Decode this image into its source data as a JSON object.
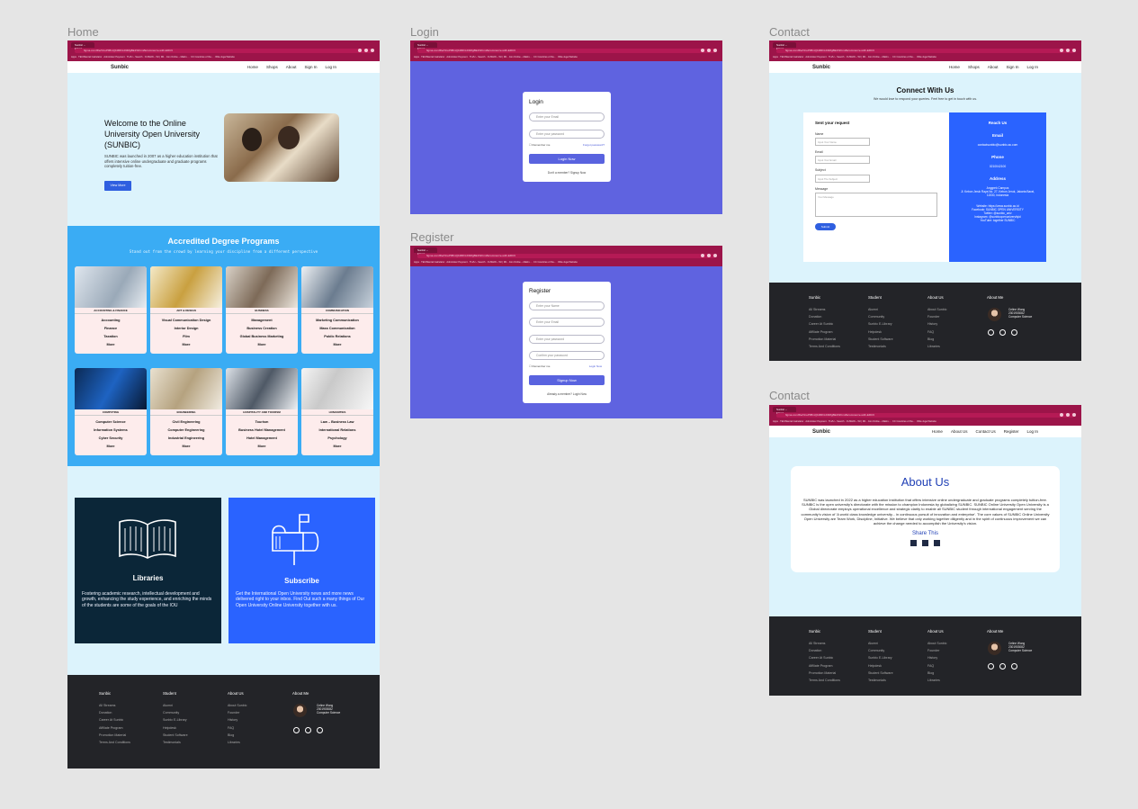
{
  "frames": {
    "home": "Home",
    "login": "Login",
    "register": "Register",
    "contact1": "Contact",
    "contact2": "Contact"
  },
  "browser": {
    "tab": "Sunbic – Figma",
    "url": "figma.com/file/OnuPlf8mQ1MRhLR3MgBE1WCmt/Ecommerce-with-ERC6",
    "bookmarks": "Apps · TEC/Mental Calculator · Administer Payment · TLVH – Search · CUSHIN – WI | M1 · Join Online – Makin... · CC Countries of the... · Wita Juga Website"
  },
  "nav": {
    "brand": "Sunbic",
    "links": [
      "Home",
      "Shops",
      "About",
      "Sign In",
      "Log In"
    ],
    "links_about": [
      "Home",
      "About Us",
      "Contact Us",
      "Register",
      "Log In"
    ]
  },
  "hero": {
    "title": "Welcome to the Online University Open University (SUNBIC)",
    "text": "SUNBIC was launched in 2007 as a higher education institution that offers intensive online undergraduate and graduate programs completely tuition-free.",
    "button": "View More"
  },
  "programs": {
    "title": "Accredited Degree Programs",
    "subtitle": "Stand out from the crowd by learning your discipline from a different perspective",
    "cards": [
      {
        "cat": "ACCOUNTING & FINANCE",
        "items": [
          "Accounting",
          "Finance",
          "Taxation",
          "More"
        ]
      },
      {
        "cat": "ART & DESIGN",
        "items": [
          "Visual Communication Design",
          "Interior Design",
          "Film",
          "More"
        ]
      },
      {
        "cat": "BUSINESS",
        "items": [
          "Management",
          "Business Creation",
          "Global Business Marketing",
          "More"
        ]
      },
      {
        "cat": "COMMUNICATION",
        "items": [
          "Marketing Communication",
          "Mass Communication",
          "Public Relations",
          "More"
        ]
      },
      {
        "cat": "COMPUTING",
        "items": [
          "Computer Science",
          "Information Systems",
          "Cyber Security",
          "More"
        ]
      },
      {
        "cat": "ENGINEERING",
        "items": [
          "Civil Engineering",
          "Computer Engineering",
          "Industrial Engineering",
          "More"
        ]
      },
      {
        "cat": "HOSPITALITY AND TOURISM",
        "items": [
          "Tourism",
          "Business Hotel Management",
          "Hotel Management",
          "More"
        ]
      },
      {
        "cat": "HUMANITIES",
        "items": [
          "Law – Business Law",
          "International Relations",
          "Psychology",
          "More"
        ]
      }
    ]
  },
  "libraries": {
    "title": "Libraries",
    "text": "Fostering academic research, intellectual development and growth, enhancing the study experience, and enriching the minds of the students are some of the goals of the IOU"
  },
  "subscribe": {
    "title": "Subscribe",
    "text": "Get the International Open University news and more news delivered right to your inbox. Find Out such a many things of Our Open University Online University together with us."
  },
  "footer": {
    "cols": [
      {
        "title": "Sunbic",
        "items": [
          "All Streams",
          "Donation",
          "Career At Sunbic",
          "Affiliate Program",
          "Promotion Material",
          "Terms And Conditions"
        ]
      },
      {
        "title": "Student",
        "items": [
          "Alumni",
          "Community",
          "Sunbic E-Library",
          "Helpdesk",
          "Student Software",
          "Testimonials"
        ]
      },
      {
        "title": "About Us",
        "items": [
          "About Sunbic",
          "Founder",
          "History",
          "FAQ",
          "Blog",
          "Libraries"
        ]
      },
      {
        "title": "About Me",
        "items": []
      }
    ],
    "me": [
      "Celine Wong",
      "2301903082",
      "Computer Science"
    ]
  },
  "login": {
    "title": "Login",
    "email": "Enter your Email",
    "password": "Enter your password",
    "remember": "Remember me",
    "forgot": "Forgot password?",
    "button": "Login Now",
    "signup_prompt": "Don't a member? Signup Now"
  },
  "register": {
    "title": "Register",
    "name": "Enter your Name",
    "email": "Enter your Email",
    "password": "Enter your password",
    "confirm": "Confirm your password",
    "remember": "Remember me",
    "login_link": "Login Now",
    "button": "Signup Now",
    "login_prompt": "Already a member? Login Now"
  },
  "contact": {
    "title": "Connect With Us",
    "subtitle": "We would love to respond your queries. Feel free to get in touch with us.",
    "form_title": "Sent your request",
    "labels": [
      "Name",
      "Email",
      "Subject",
      "Message"
    ],
    "placeholders": [
      "Input Your Name",
      "Input Your Email",
      "Input The Subject",
      "Your Message"
    ],
    "submit": "Submit",
    "reach": {
      "title": "Reach Us",
      "email_h": "Email",
      "email": "contactsunbic@sunbic.ac.com",
      "phone_h": "Phone",
      "phone": "0210042100",
      "address_h": "Address",
      "address": "Anggrek Campus\nJl. Kebon Jeruk Raya No. 27, Kebon Jeruk, Jakarta Barat, 11530, Indonesia",
      "socials": "Website: https://www.sunbic.ac.id\nFacebook: SUNBIC OPEN UNIVERSITY\nTwitter: @sunbic_univ\nInstagram: @sunbicopenuniversityid\nYouTube: together SUNBIC"
    }
  },
  "about": {
    "title": "About Us",
    "text": "SUNBIC was launched in 2022 as a higher education institution that offers intensive online undergraduate and graduate programs completely tuition-free. SUNBIC is the open university's directorate with the mission to champion Indonesia by globalizing SUNBIC. SUNBIC Online University Open University is a Global directorate employs operational excellence and strategic clarity to enable all SUNBIC student through international engagement serving the community's vision of 'A world class knowledge university... in continuous pursuit of innovation and enterprise'. The core values of SUNBIC Online University Open University are Team Work, Discipline, Initiative. We believe that only working together diligently and in the spirit of continuous improvement we can achieve the change needed to accomplish the University's vision.",
    "share": "Share This"
  },
  "colors": {
    "accent": "#2f5fe0",
    "programs_bg": "#3aacf4",
    "auth_bg": "#5f63e0",
    "footer_bg": "#232428",
    "chrome": "#9c1449"
  }
}
